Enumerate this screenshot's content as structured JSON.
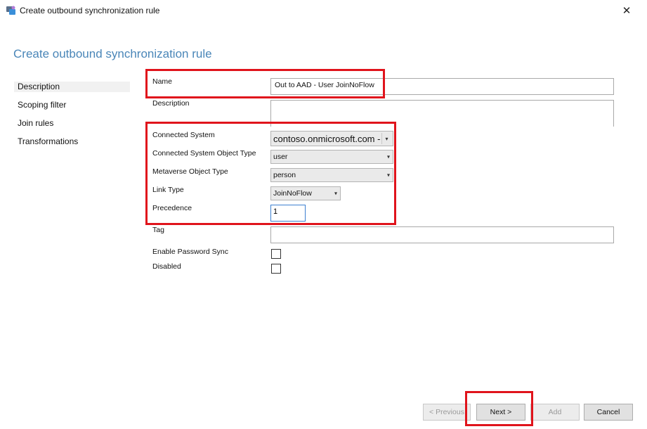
{
  "window": {
    "title": "Create outbound synchronization rule",
    "app_icon": "sync-app-icon",
    "close_glyph": "✕"
  },
  "page": {
    "title": "Create outbound synchronization rule"
  },
  "sidebar": {
    "items": [
      {
        "label": "Description",
        "selected": true
      },
      {
        "label": "Scoping filter",
        "selected": false
      },
      {
        "label": "Join rules",
        "selected": false
      },
      {
        "label": "Transformations",
        "selected": false
      }
    ]
  },
  "form": {
    "name": {
      "label": "Name",
      "value": "Out to AAD - User JoinNoFlow"
    },
    "description": {
      "label": "Description",
      "value": ""
    },
    "connected_system": {
      "label": "Connected System",
      "value": "contoso.onmicrosoft.com -"
    },
    "connected_system_object_type": {
      "label": "Connected System Object Type",
      "value": "user"
    },
    "metaverse_object_type": {
      "label": "Metaverse Object Type",
      "value": "person"
    },
    "link_type": {
      "label": "Link Type",
      "value": "JoinNoFlow"
    },
    "precedence": {
      "label": "Precedence",
      "value": "1"
    },
    "tag": {
      "label": "Tag",
      "value": ""
    },
    "enable_password_sync": {
      "label": "Enable Password Sync",
      "checked": false
    },
    "disabled": {
      "label": "Disabled",
      "checked": false
    }
  },
  "buttons": {
    "previous": "< Previous",
    "next": "Next >",
    "add": "Add",
    "cancel": "Cancel"
  },
  "colors": {
    "accent_title": "#4a86b8",
    "highlight_red": "#e0141c",
    "focus_border": "#3c7fd0"
  }
}
